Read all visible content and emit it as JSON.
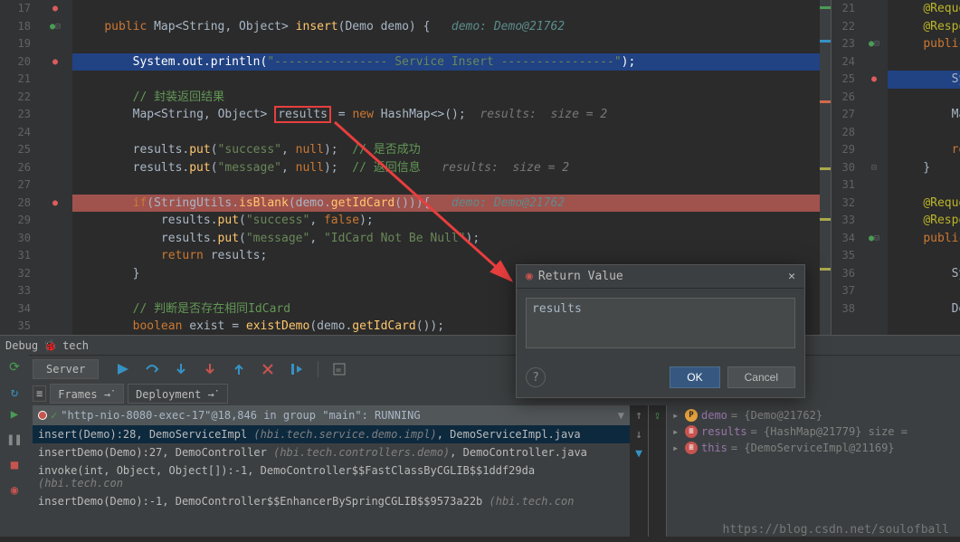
{
  "left": {
    "lines": [
      {
        "n": 17,
        "bp": true
      },
      {
        "n": 18,
        "html": "    <span class='kw'>public</span> <span class='cls'>Map</span>&lt;<span class='cls'>String</span>, <span class='cls'>Object</span>&gt; <span class='fn'>insert</span>(<span class='cls'>Demo</span> demo) {   <span class='inlay-var'>demo: Demo@21762</span>"
      },
      {
        "n": 19,
        "html": ""
      },
      {
        "n": 20,
        "bp": true,
        "cls": "hl-blue",
        "html": "        System.out.println(<span class='str'>\"---------------- Service Insert ----------------\"</span>);"
      },
      {
        "n": 21,
        "html": ""
      },
      {
        "n": 22,
        "html": "        <span class='cmt-cn'>// 封装返回结果</span>"
      },
      {
        "n": 23,
        "html": "        <span class='cls'>Map</span>&lt;<span class='cls'>String</span>, <span class='cls'>Object</span>&gt; <span class='boxed'>results</span> = <span class='kw'>new</span> <span class='cls'>HashMap</span>&lt;&gt;();  <span class='inlay'>results:  size = 2</span>"
      },
      {
        "n": 24,
        "html": ""
      },
      {
        "n": 25,
        "html": "        results.<span class='fn'>put</span>(<span class='str'>\"success\"</span>, <span class='kw'>null</span>);  <span class='cmt-cn'>// 是否成功</span>"
      },
      {
        "n": 26,
        "html": "        results.<span class='fn'>put</span>(<span class='str'>\"message\"</span>, <span class='kw'>null</span>);  <span class='cmt-cn'>// 返回信息</span>   <span class='inlay'>results:  size = 2</span>"
      },
      {
        "n": 27,
        "html": ""
      },
      {
        "n": 28,
        "bp": true,
        "cls": "hl-red",
        "html": "        <span class='kw'>if</span>(StringUtils.<span class='fn'>isBlank</span>(demo.<span class='fn'>getIdCard</span>())){   <span class='inlay-var'>demo: Demo@21762</span>"
      },
      {
        "n": 29,
        "html": "            results.<span class='fn'>put</span>(<span class='str'>\"success\"</span>, <span class='kw'>false</span>);"
      },
      {
        "n": 30,
        "html": "            results.<span class='fn'>put</span>(<span class='str'>\"message\"</span>, <span class='str'>\"IdCard Not Be Null\"</span>);"
      },
      {
        "n": 31,
        "html": "            <span class='kw'>return</span> results;"
      },
      {
        "n": 32,
        "html": "        }"
      },
      {
        "n": 33,
        "html": ""
      },
      {
        "n": 34,
        "html": "        <span class='cmt-cn'>// 判断是否存在相同IdCard</span>"
      },
      {
        "n": 35,
        "html": "        <span class='kw'>boolean</span> exist = <span class='fn'>existDemo</span>(demo.<span class='fn'>getIdCard</span>());"
      }
    ]
  },
  "right": {
    "lines": [
      {
        "n": 21,
        "html": "    <span class='ann'>@Request</span>"
      },
      {
        "n": 22,
        "html": "    <span class='ann'>@Respons</span>"
      },
      {
        "n": 23,
        "html": "    <span class='kw'>public</span> M"
      },
      {
        "n": 24,
        "html": ""
      },
      {
        "n": 25,
        "bp": true,
        "cls": "hl-blue",
        "html": "        Syst"
      },
      {
        "n": 26,
        "html": ""
      },
      {
        "n": 27,
        "html": "        Map&lt;"
      },
      {
        "n": 28,
        "html": ""
      },
      {
        "n": 29,
        "html": "        <span class='kw'>retu</span>"
      },
      {
        "n": 30,
        "html": "    }"
      },
      {
        "n": 31,
        "html": ""
      },
      {
        "n": 32,
        "html": "    <span class='ann'>@Request</span>"
      },
      {
        "n": 33,
        "html": "    <span class='ann'>@Respons</span>"
      },
      {
        "n": 34,
        "html": "    <span class='kw'>public</span> D"
      },
      {
        "n": 35,
        "html": ""
      },
      {
        "n": 36,
        "html": "        Syst"
      },
      {
        "n": 37,
        "html": ""
      },
      {
        "n": 38,
        "html": "        Demo"
      }
    ]
  },
  "debug": {
    "tab": "tech",
    "server_tab": "Server",
    "frames_tab": "Frames",
    "deployment_tab": "Deployment",
    "thread": "\"http-nio-8080-exec-17\"@18,846 in group \"main\": RUNNING",
    "stack": [
      {
        "m": "insert(Demo):28, DemoServiceImpl ",
        "p": "(hbi.tech.service.demo.impl)",
        "f": ", DemoServiceImpl.java",
        "sel": true
      },
      {
        "m": "insertDemo(Demo):27, DemoController ",
        "p": "(hbi.tech.controllers.demo)",
        "f": ", DemoController.java"
      },
      {
        "m": "invoke(int, Object, Object[]):-1, DemoController$$FastClassByCGLIB$$1ddf29da ",
        "p": "(hbi.tech.con",
        "f": ""
      },
      {
        "m": "insertDemo(Demo):-1, DemoController$$EnhancerBySpringCGLIB$$9573a22b ",
        "p": "(hbi.tech.con",
        "f": ""
      }
    ],
    "vars": [
      {
        "icon": "p",
        "name": "demo",
        "val": " = {Demo@21762}"
      },
      {
        "icon": "f",
        "name": "results",
        "val": " = {HashMap@21779}  size ="
      },
      {
        "icon": "f",
        "name": "this",
        "val": " = {DemoServiceImpl@21169}"
      }
    ]
  },
  "dialog": {
    "title": "Return Value",
    "value": "results",
    "ok": "OK",
    "cancel": "Cancel"
  },
  "watermark": "https://blog.csdn.net/soulofball",
  "debug_label": "Debug"
}
